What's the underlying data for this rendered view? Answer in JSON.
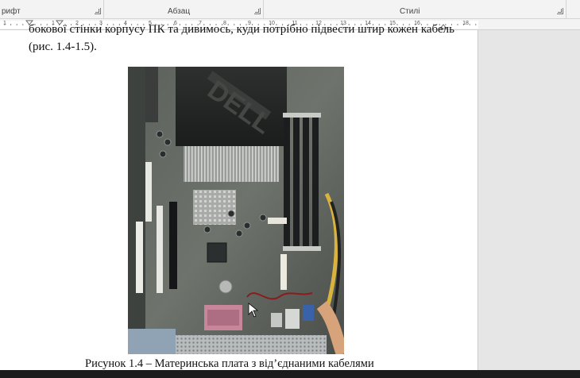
{
  "ribbon": {
    "groups": [
      {
        "label": "рифт"
      },
      {
        "label": "Абзац"
      },
      {
        "label": "Стилі"
      }
    ]
  },
  "ruler": {
    "numbers": [
      "1",
      "1",
      "2",
      "3",
      "4",
      "5",
      "6",
      "7",
      "8",
      "9",
      "10",
      "11",
      "12",
      "13",
      "14",
      "15",
      "16",
      "18"
    ]
  },
  "document": {
    "line_cut": "бокової стінки корпусу ПК та дивимось, куди потрібно підвести штир кожен кабель",
    "line_ref": "(рис. 1.4-1.5).",
    "figure_icon": "motherboard-photo",
    "caption": "Рисунок 1.4 – Материнська плата з від’єднаними кабелями"
  }
}
